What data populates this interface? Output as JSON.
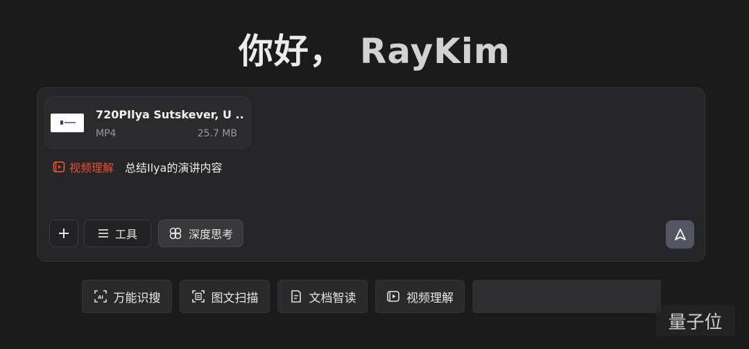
{
  "greeting": {
    "hello": "你好，",
    "name": "RayKim"
  },
  "attachment": {
    "name": "720PIlya Sutskever, U ...",
    "type": "MP4",
    "size": "25.7 MB"
  },
  "prompt": {
    "skill_tag": "视频理解",
    "skill_icon": "video-play-icon",
    "skill_color": "#e8502f",
    "text": "总结Ilya的演讲内容"
  },
  "toolbar": {
    "add_icon": "plus-icon",
    "tools_label": "工具",
    "tools_icon": "menu-lines-icon",
    "deep_think_label": "深度思考",
    "deep_think_icon": "clover-icon",
    "send_icon": "arrow-up-icon"
  },
  "quick_actions": [
    {
      "label": "万能识搜",
      "icon": "ai-scan-icon"
    },
    {
      "label": "图文扫描",
      "icon": "doc-scan-icon"
    },
    {
      "label": "文档智读",
      "icon": "doc-read-icon"
    },
    {
      "label": "视频理解",
      "icon": "video-icon"
    }
  ],
  "watermark": "量子位"
}
